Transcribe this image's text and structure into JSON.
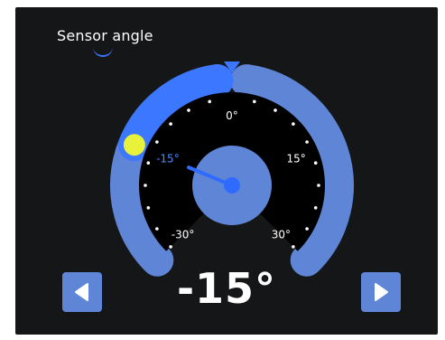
{
  "sensor": {
    "title": "Sensor angle",
    "current_value": -15,
    "current_label": "-15°",
    "range": [
      -30,
      30
    ],
    "ticks": [
      "-30°",
      "-15°",
      "0°",
      "15°",
      "30°"
    ]
  },
  "colors": {
    "background": "#151618",
    "track": "#5f86d6",
    "active_arc": "#3b78ff",
    "handle": "#e8f23a",
    "needle": "#2f6bff",
    "hub": "#5f86d6",
    "dial_face": "#000000",
    "marker": "#3b78ff"
  },
  "icons": {
    "left": "arrow-left-icon",
    "right": "arrow-right-icon",
    "marker": "triangle-down-icon"
  }
}
